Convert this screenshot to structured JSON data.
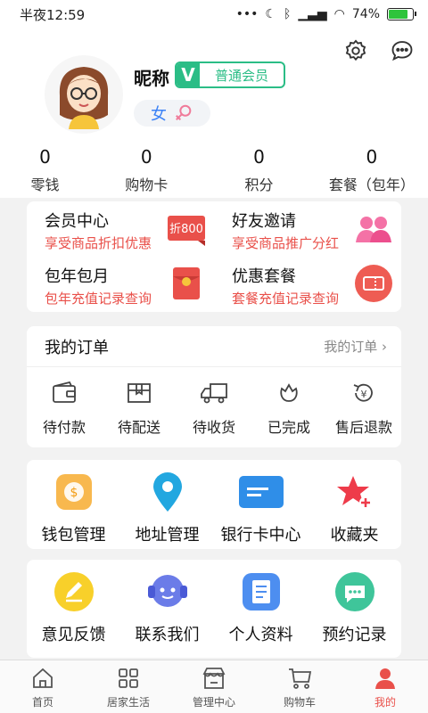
{
  "status": {
    "time": "半夜12:59",
    "battery": "74%",
    "battery_level": 0.74
  },
  "profile": {
    "nickname": "昵称",
    "member_badge": "V",
    "member_text": "普通会员",
    "gender": "女",
    "stats": [
      {
        "value": "0",
        "label": "零钱"
      },
      {
        "value": "0",
        "label": "购物卡"
      },
      {
        "value": "0",
        "label": "积分"
      },
      {
        "value": "0",
        "label": "套餐（包年）"
      }
    ]
  },
  "promo": [
    {
      "title": "会员中心",
      "subtitle": "享受商品折扣优惠",
      "badge": "折800",
      "icon": "discount-tag-icon"
    },
    {
      "title": "好友邀请",
      "subtitle": "享受商品推广分红",
      "icon": "friends-icon"
    },
    {
      "title": "包年包月",
      "subtitle": "包年充值记录查询",
      "icon": "red-envelope-icon"
    },
    {
      "title": "优惠套餐",
      "subtitle": "套餐充值记录查询",
      "icon": "ticket-icon"
    }
  ],
  "orders": {
    "title": "我的订单",
    "more": "我的订单",
    "items": [
      {
        "label": "待付款",
        "icon": "wallet-icon"
      },
      {
        "label": "待配送",
        "icon": "box-icon"
      },
      {
        "label": "待收货",
        "icon": "truck-icon"
      },
      {
        "label": "已完成",
        "icon": "flower-icon"
      },
      {
        "label": "售后退款",
        "icon": "refund-icon"
      }
    ]
  },
  "tools1": [
    {
      "label": "钱包管理",
      "icon": "wallet-coin-icon"
    },
    {
      "label": "地址管理",
      "icon": "location-pin-icon"
    },
    {
      "label": "银行卡中心",
      "icon": "bank-card-icon"
    },
    {
      "label": "收藏夹",
      "icon": "star-plus-icon"
    }
  ],
  "tools2": [
    {
      "label": "意见反馈",
      "icon": "feedback-pencil-icon"
    },
    {
      "label": "联系我们",
      "icon": "headset-icon"
    },
    {
      "label": "个人资料",
      "icon": "document-icon"
    },
    {
      "label": "预约记录",
      "icon": "chat-bubble-icon"
    }
  ],
  "tabs": [
    {
      "label": "首页",
      "icon": "home-icon"
    },
    {
      "label": "居家生活",
      "icon": "grid-icon"
    },
    {
      "label": "管理中心",
      "icon": "store-icon"
    },
    {
      "label": "购物车",
      "icon": "cart-icon"
    },
    {
      "label": "我的",
      "icon": "user-icon",
      "active": true
    }
  ],
  "colors": {
    "accent": "#2bbd86",
    "red": "#e9504a"
  }
}
